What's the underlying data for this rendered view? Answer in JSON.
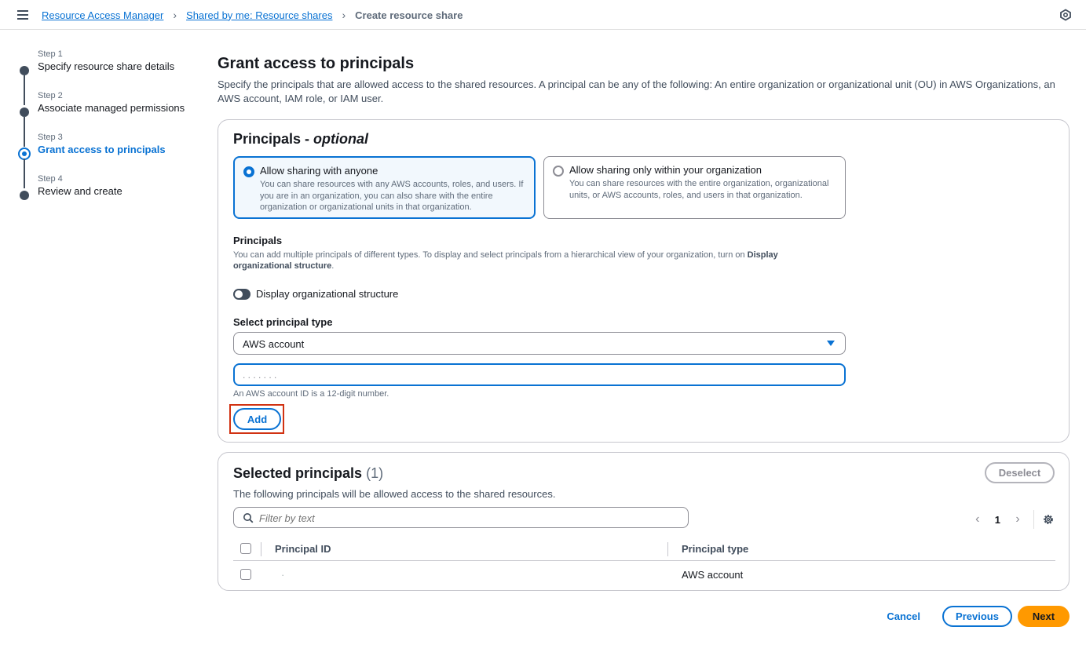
{
  "breadcrumb": {
    "items": [
      "Resource Access Manager",
      "Shared by me: Resource shares"
    ],
    "current": "Create resource share"
  },
  "steps": [
    {
      "num": "Step 1",
      "label": "Specify resource share details"
    },
    {
      "num": "Step 2",
      "label": "Associate managed permissions"
    },
    {
      "num": "Step 3",
      "label": "Grant access to principals"
    },
    {
      "num": "Step 4",
      "label": "Review and create"
    }
  ],
  "page": {
    "title": "Grant access to principals",
    "description": "Specify the principals that are allowed access to the shared resources. A principal can be any of the following: An entire organization or organizational unit (OU) in AWS Organizations, an AWS account, IAM role, or IAM user."
  },
  "principals_card": {
    "title": "Principals - ",
    "title_optional": "optional",
    "option_anyone": {
      "label": "Allow sharing with anyone",
      "desc": "You can share resources with any AWS accounts, roles, and users. If you are in an organization, you can also share with the entire organization or organizational units in that organization."
    },
    "option_org": {
      "label": "Allow sharing only within your organization",
      "desc": "You can share resources with the entire organization, organizational units, or AWS accounts, roles, and users in that organization."
    },
    "principals_label": "Principals",
    "principals_desc": "You can add multiple principals of different types. To display and select principals from a hierarchical view of your organization, turn on ",
    "principals_desc_bold": "Display organizational structure",
    "principals_desc_end": ".",
    "toggle_label": "Display organizational structure",
    "select_label": "Select principal type",
    "select_value": "AWS account",
    "input_value": ". . . . . . .",
    "hint": "An AWS account ID is a 12-digit number.",
    "add_button": "Add"
  },
  "selected_card": {
    "title": "Selected principals",
    "count": "(1)",
    "deselect_button": "Deselect",
    "description": "The following principals will be allowed access to the shared resources.",
    "filter_placeholder": "Filter by text",
    "page_number": "1",
    "columns": [
      "Principal ID",
      "Principal type"
    ],
    "rows": [
      {
        "id": "·",
        "type": "AWS account"
      }
    ]
  },
  "footer": {
    "cancel": "Cancel",
    "previous": "Previous",
    "next": "Next"
  },
  "colors": {
    "accent": "#0972d3",
    "primary_button": "#ff9900",
    "highlight": "#d13212"
  }
}
